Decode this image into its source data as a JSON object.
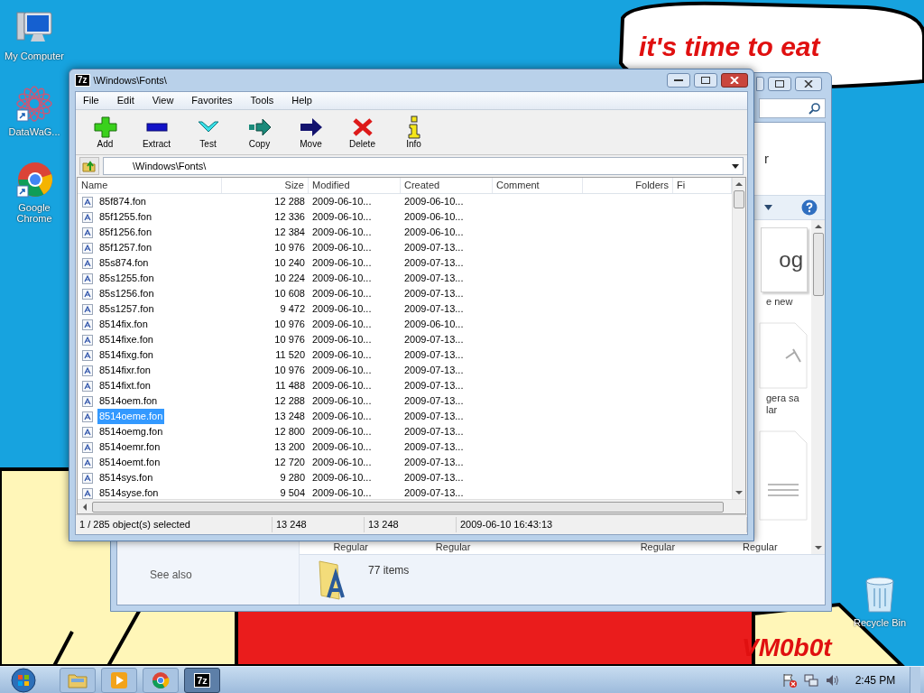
{
  "desktop_icons": [
    {
      "kind": "computer",
      "label": "My Computer"
    },
    {
      "kind": "star",
      "label": "DataWaG..."
    },
    {
      "kind": "chrome",
      "label": "Google Chrome"
    }
  ],
  "wallpaper": {
    "bubble_text": "it's time to eat",
    "signature": "VM0b0t"
  },
  "recycle_bin": {
    "label": "Recycle Bin"
  },
  "explorer": {
    "heading_fragment": "r",
    "tiles": [
      {
        "kind": "sample",
        "caption": "og",
        "label": "e new"
      },
      {
        "kind": "glyph",
        "label": "gera sa lar"
      },
      {
        "kind": "lines"
      }
    ],
    "bottom_labels": [
      "Regular",
      "Regular",
      "Regular",
      "Regular"
    ],
    "see_also": "See also",
    "item_count": "77 items"
  },
  "window": {
    "icon_text": "7z",
    "title": "\\Windows\\Fonts\\",
    "menu": [
      "File",
      "Edit",
      "View",
      "Favorites",
      "Tools",
      "Help"
    ],
    "toolbar": [
      {
        "kind": "add",
        "label": "Add"
      },
      {
        "kind": "extract",
        "label": "Extract"
      },
      {
        "kind": "test",
        "label": "Test"
      },
      {
        "kind": "copy",
        "label": "Copy"
      },
      {
        "kind": "move",
        "label": "Move"
      },
      {
        "kind": "delete",
        "label": "Delete"
      },
      {
        "kind": "info",
        "label": "Info"
      }
    ],
    "address": "\\Windows\\Fonts\\",
    "columns": [
      {
        "label": "Name",
        "numeric": false
      },
      {
        "label": "Size",
        "numeric": true
      },
      {
        "label": "Modified",
        "numeric": false
      },
      {
        "label": "Created",
        "numeric": false
      },
      {
        "label": "Comment",
        "numeric": false
      },
      {
        "label": "Folders",
        "numeric": true
      },
      {
        "label": "Fi",
        "numeric": false
      }
    ],
    "rows": [
      {
        "name": "85f874.fon",
        "size": "12 288",
        "modified": "2009-06-10...",
        "created": "2009-06-10...",
        "selected": false
      },
      {
        "name": "85f1255.fon",
        "size": "12 336",
        "modified": "2009-06-10...",
        "created": "2009-06-10...",
        "selected": false
      },
      {
        "name": "85f1256.fon",
        "size": "12 384",
        "modified": "2009-06-10...",
        "created": "2009-06-10...",
        "selected": false
      },
      {
        "name": "85f1257.fon",
        "size": "10 976",
        "modified": "2009-06-10...",
        "created": "2009-07-13...",
        "selected": false
      },
      {
        "name": "85s874.fon",
        "size": "10 240",
        "modified": "2009-06-10...",
        "created": "2009-07-13...",
        "selected": false
      },
      {
        "name": "85s1255.fon",
        "size": "10 224",
        "modified": "2009-06-10...",
        "created": "2009-07-13...",
        "selected": false
      },
      {
        "name": "85s1256.fon",
        "size": "10 608",
        "modified": "2009-06-10...",
        "created": "2009-07-13...",
        "selected": false
      },
      {
        "name": "85s1257.fon",
        "size": "9 472",
        "modified": "2009-06-10...",
        "created": "2009-07-13...",
        "selected": false
      },
      {
        "name": "8514fix.fon",
        "size": "10 976",
        "modified": "2009-06-10...",
        "created": "2009-06-10...",
        "selected": false
      },
      {
        "name": "8514fixe.fon",
        "size": "10 976",
        "modified": "2009-06-10...",
        "created": "2009-07-13...",
        "selected": false
      },
      {
        "name": "8514fixg.fon",
        "size": "11 520",
        "modified": "2009-06-10...",
        "created": "2009-07-13...",
        "selected": false
      },
      {
        "name": "8514fixr.fon",
        "size": "10 976",
        "modified": "2009-06-10...",
        "created": "2009-07-13...",
        "selected": false
      },
      {
        "name": "8514fixt.fon",
        "size": "11 488",
        "modified": "2009-06-10...",
        "created": "2009-07-13...",
        "selected": false
      },
      {
        "name": "8514oem.fon",
        "size": "12 288",
        "modified": "2009-06-10...",
        "created": "2009-07-13...",
        "selected": false
      },
      {
        "name": "8514oeme.fon",
        "size": "13 248",
        "modified": "2009-06-10...",
        "created": "2009-07-13...",
        "selected": true
      },
      {
        "name": "8514oemg.fon",
        "size": "12 800",
        "modified": "2009-06-10...",
        "created": "2009-07-13...",
        "selected": false
      },
      {
        "name": "8514oemr.fon",
        "size": "13 200",
        "modified": "2009-06-10...",
        "created": "2009-07-13...",
        "selected": false
      },
      {
        "name": "8514oemt.fon",
        "size": "12 720",
        "modified": "2009-06-10...",
        "created": "2009-07-13...",
        "selected": false
      },
      {
        "name": "8514sys.fon",
        "size": "9 280",
        "modified": "2009-06-10...",
        "created": "2009-07-13...",
        "selected": false
      },
      {
        "name": "8514syse.fon",
        "size": "9 504",
        "modified": "2009-06-10...",
        "created": "2009-07-13...",
        "selected": false
      }
    ],
    "status": [
      "1 / 285 object(s) selected",
      "13 248",
      "13 248",
      "2009-06-10 16:43:13"
    ]
  },
  "taskbar": {
    "apps": [
      {
        "kind": "explorer",
        "selected": false
      },
      {
        "kind": "media",
        "selected": false
      },
      {
        "kind": "chrome",
        "selected": false
      },
      {
        "kind": "archiver",
        "badge": "7z",
        "selected": true
      }
    ],
    "clock": "2:45 PM"
  }
}
